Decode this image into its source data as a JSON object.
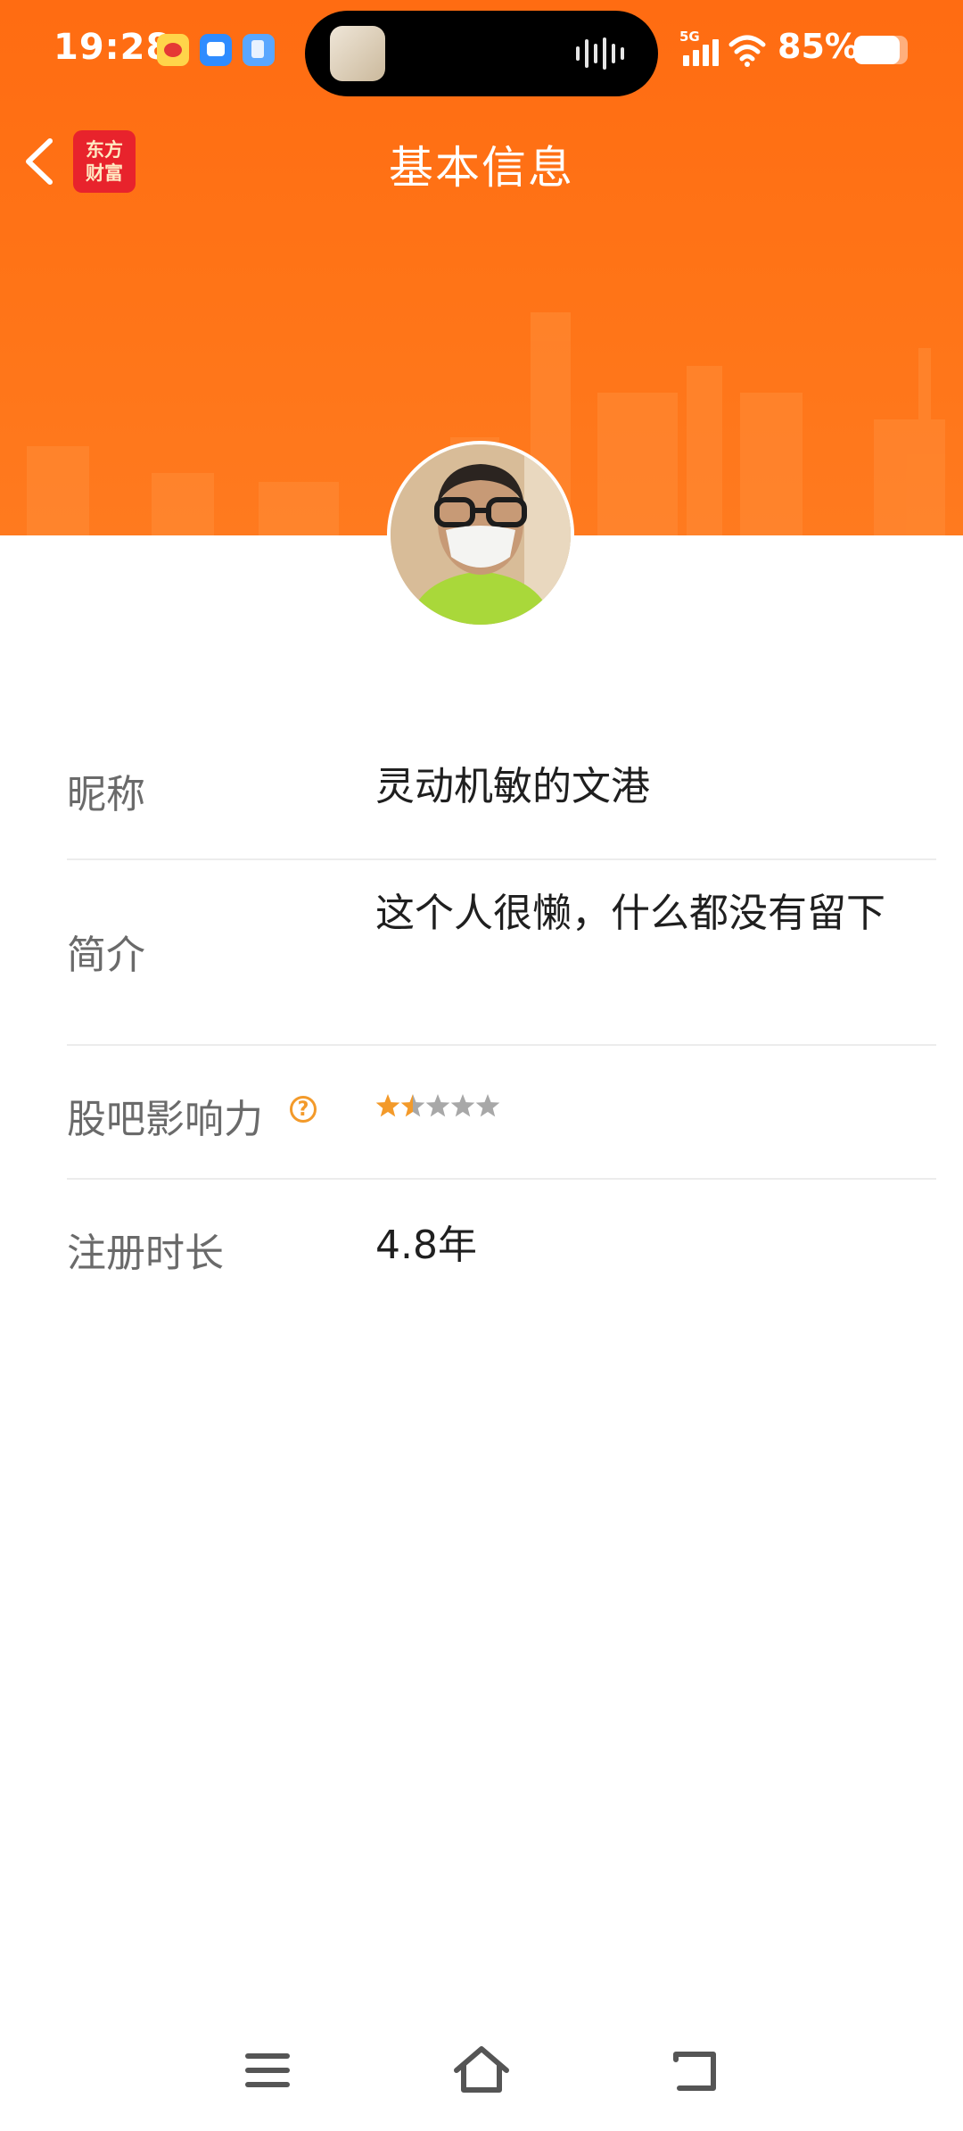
{
  "status_bar": {
    "time": "19:28",
    "network": "5G",
    "battery_percent": "85%",
    "battery_level": 0.85,
    "notification_icons": [
      "weibo-icon",
      "message-icon",
      "note-icon"
    ]
  },
  "header": {
    "title": "基本信息",
    "logo_lines": [
      "东方",
      "财富"
    ]
  },
  "profile": {
    "nickname_label": "昵称",
    "nickname": "灵动机敏的文港",
    "bio_label": "简介",
    "bio": "这个人很懒，什么都没有留下",
    "influence_label": "股吧影响力",
    "influence_stars": 1.5,
    "influence_max": 5,
    "help_glyph": "?",
    "registration_label": "注册时长",
    "registration_duration": "4.8年"
  },
  "colors": {
    "accent": "#ff6c12",
    "star_active": "#f39a2a",
    "star_inactive": "#a8a8a8",
    "label_gray": "#6a6a6a",
    "logo_red": "#e8232c"
  },
  "navbar": {
    "icons": [
      "menu-icon",
      "home-icon",
      "back-icon"
    ]
  }
}
